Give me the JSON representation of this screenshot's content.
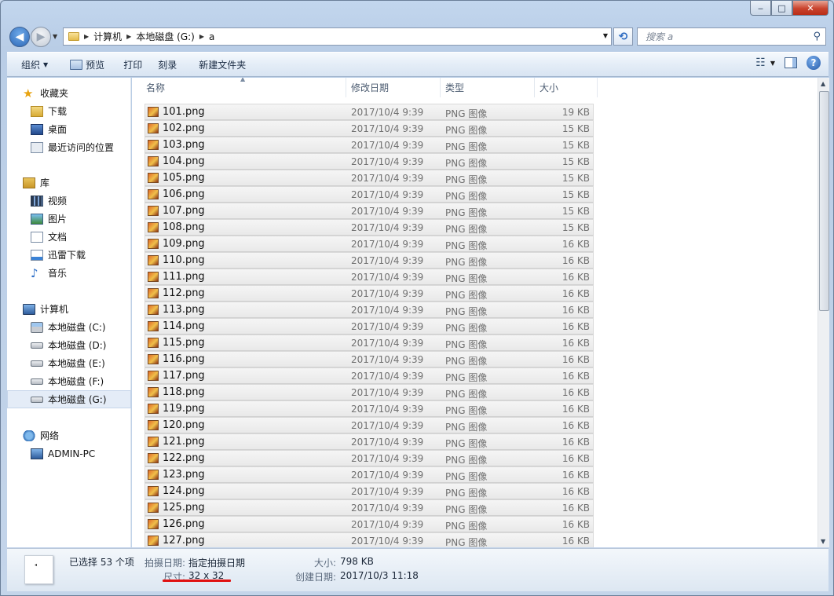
{
  "window": {
    "caption_min": "‒",
    "caption_max": "□",
    "caption_close": "✕"
  },
  "address": {
    "crumbs": [
      "计算机",
      "本地磁盘 (G:)",
      "a"
    ]
  },
  "search": {
    "placeholder": "搜索 a"
  },
  "toolbar": {
    "organize": "组织",
    "preview": "预览",
    "print": "打印",
    "burn": "刻录",
    "new_folder": "新建文件夹"
  },
  "nav": {
    "favorites": {
      "label": "收藏夹",
      "items": [
        "下载",
        "桌面",
        "最近访问的位置"
      ]
    },
    "libraries": {
      "label": "库",
      "items": [
        "视频",
        "图片",
        "文档",
        "迅雷下载",
        "音乐"
      ]
    },
    "computer": {
      "label": "计算机",
      "items": [
        "本地磁盘 (C:)",
        "本地磁盘 (D:)",
        "本地磁盘 (E:)",
        "本地磁盘 (F:)",
        "本地磁盘 (G:)"
      ],
      "selected_index": 4
    },
    "network": {
      "label": "网络",
      "items": [
        "ADMIN-PC"
      ]
    }
  },
  "columns": {
    "name": "名称",
    "date": "修改日期",
    "type": "类型",
    "size": "大小"
  },
  "files": [
    {
      "name": "101.png",
      "date": "2017/10/4 9:39",
      "type": "PNG 图像",
      "size": "19 KB"
    },
    {
      "name": "102.png",
      "date": "2017/10/4 9:39",
      "type": "PNG 图像",
      "size": "15 KB"
    },
    {
      "name": "103.png",
      "date": "2017/10/4 9:39",
      "type": "PNG 图像",
      "size": "15 KB"
    },
    {
      "name": "104.png",
      "date": "2017/10/4 9:39",
      "type": "PNG 图像",
      "size": "15 KB"
    },
    {
      "name": "105.png",
      "date": "2017/10/4 9:39",
      "type": "PNG 图像",
      "size": "15 KB"
    },
    {
      "name": "106.png",
      "date": "2017/10/4 9:39",
      "type": "PNG 图像",
      "size": "15 KB"
    },
    {
      "name": "107.png",
      "date": "2017/10/4 9:39",
      "type": "PNG 图像",
      "size": "15 KB"
    },
    {
      "name": "108.png",
      "date": "2017/10/4 9:39",
      "type": "PNG 图像",
      "size": "15 KB"
    },
    {
      "name": "109.png",
      "date": "2017/10/4 9:39",
      "type": "PNG 图像",
      "size": "16 KB"
    },
    {
      "name": "110.png",
      "date": "2017/10/4 9:39",
      "type": "PNG 图像",
      "size": "16 KB"
    },
    {
      "name": "111.png",
      "date": "2017/10/4 9:39",
      "type": "PNG 图像",
      "size": "16 KB"
    },
    {
      "name": "112.png",
      "date": "2017/10/4 9:39",
      "type": "PNG 图像",
      "size": "16 KB"
    },
    {
      "name": "113.png",
      "date": "2017/10/4 9:39",
      "type": "PNG 图像",
      "size": "16 KB"
    },
    {
      "name": "114.png",
      "date": "2017/10/4 9:39",
      "type": "PNG 图像",
      "size": "16 KB"
    },
    {
      "name": "115.png",
      "date": "2017/10/4 9:39",
      "type": "PNG 图像",
      "size": "16 KB"
    },
    {
      "name": "116.png",
      "date": "2017/10/4 9:39",
      "type": "PNG 图像",
      "size": "16 KB"
    },
    {
      "name": "117.png",
      "date": "2017/10/4 9:39",
      "type": "PNG 图像",
      "size": "16 KB"
    },
    {
      "name": "118.png",
      "date": "2017/10/4 9:39",
      "type": "PNG 图像",
      "size": "16 KB"
    },
    {
      "name": "119.png",
      "date": "2017/10/4 9:39",
      "type": "PNG 图像",
      "size": "16 KB"
    },
    {
      "name": "120.png",
      "date": "2017/10/4 9:39",
      "type": "PNG 图像",
      "size": "16 KB"
    },
    {
      "name": "121.png",
      "date": "2017/10/4 9:39",
      "type": "PNG 图像",
      "size": "16 KB"
    },
    {
      "name": "122.png",
      "date": "2017/10/4 9:39",
      "type": "PNG 图像",
      "size": "16 KB"
    },
    {
      "name": "123.png",
      "date": "2017/10/4 9:39",
      "type": "PNG 图像",
      "size": "16 KB"
    },
    {
      "name": "124.png",
      "date": "2017/10/4 9:39",
      "type": "PNG 图像",
      "size": "16 KB"
    },
    {
      "name": "125.png",
      "date": "2017/10/4 9:39",
      "type": "PNG 图像",
      "size": "16 KB"
    },
    {
      "name": "126.png",
      "date": "2017/10/4 9:39",
      "type": "PNG 图像",
      "size": "16 KB"
    },
    {
      "name": "127.png",
      "date": "2017/10/4 9:39",
      "type": "PNG 图像",
      "size": "16 KB"
    }
  ],
  "details": {
    "selected_count": "已选择 53 个项",
    "date_taken_label": "拍摄日期:",
    "date_taken_value": "指定拍摄日期",
    "dimensions_label": "尺寸:",
    "dimensions_value": "32 x 32",
    "size_label": "大小:",
    "size_value": "798 KB",
    "created_label": "创建日期:",
    "created_value": "2017/10/3 11:18"
  },
  "colors": {
    "annotation_underline": "#e01010",
    "selected_row_bg": "#ececec"
  }
}
